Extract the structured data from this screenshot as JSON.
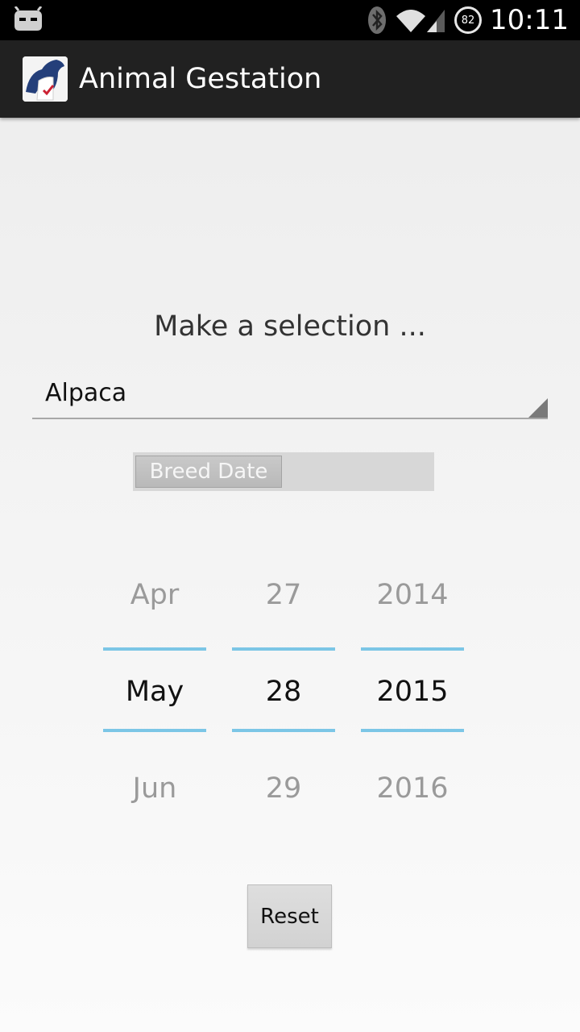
{
  "status_bar": {
    "time": "10:11",
    "battery_level": "82",
    "icons": [
      "android-bot-icon",
      "bluetooth-icon",
      "wifi-icon",
      "cell-signal-icon",
      "battery-icon"
    ]
  },
  "action_bar": {
    "title": "Animal Gestation",
    "icon": "horse-app-icon"
  },
  "main": {
    "prompt": "Make a selection ...",
    "animal_select": {
      "selected": "Alpaca"
    },
    "breed_toggle": {
      "label": "Breed Date"
    },
    "date_picker": {
      "month": {
        "prev": "Apr",
        "current": "May",
        "next": "Jun"
      },
      "day": {
        "prev": "27",
        "current": "28",
        "next": "29"
      },
      "year": {
        "prev": "2014",
        "current": "2015",
        "next": "2016"
      }
    },
    "reset_label": "Reset"
  },
  "colors": {
    "status_bar": "#000000",
    "action_bar": "#212121",
    "picker_divider": "#7cc6e6"
  }
}
